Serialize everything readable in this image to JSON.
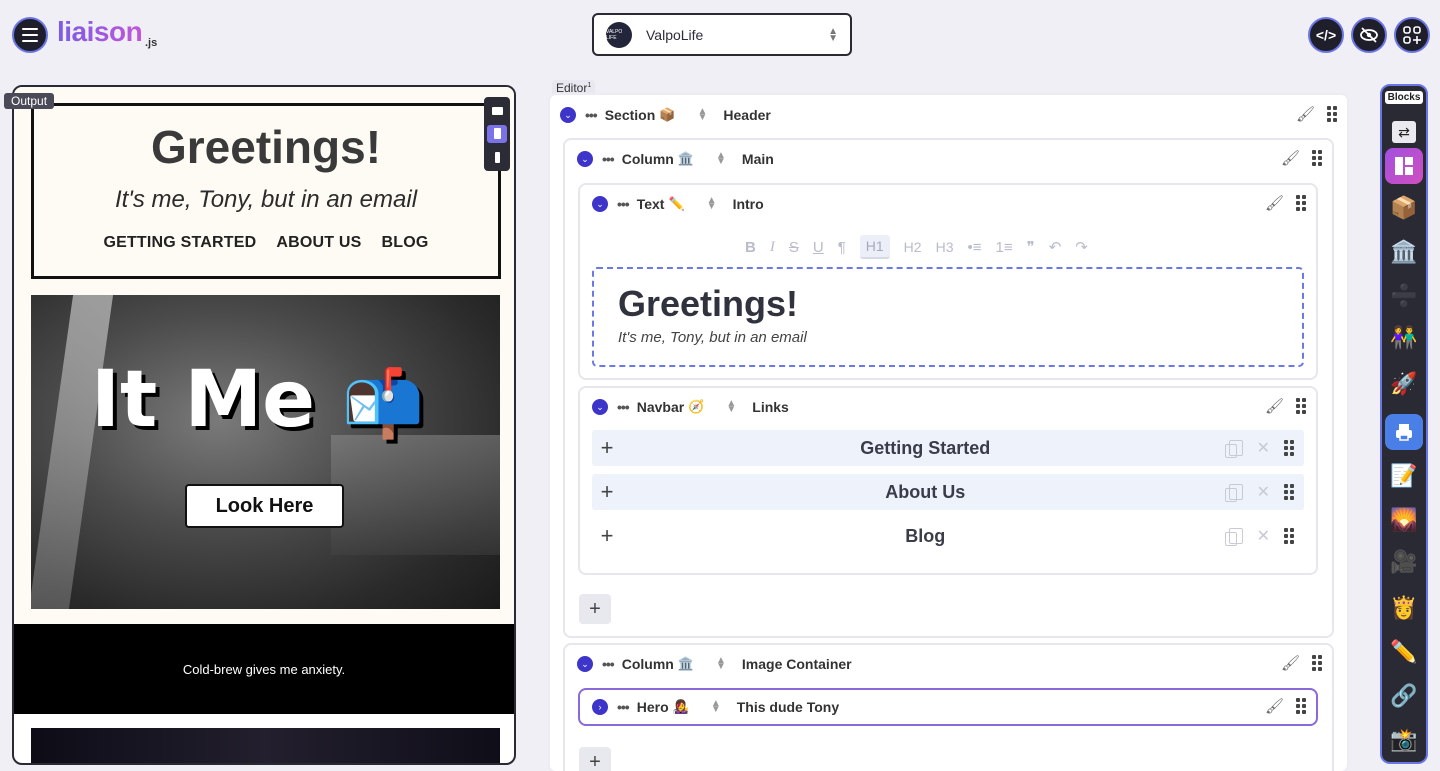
{
  "app": {
    "logo_text": "liaison",
    "logo_suffix": ".js",
    "site_name": "ValpoLife",
    "site_avatar_text": "VALPO LIFE",
    "code_icon": "code-icon",
    "hide_icon": "eye-slash-icon",
    "apps_icon": "apps-add-icon"
  },
  "output": {
    "tag": "Output",
    "email_title": "Greetings!",
    "email_subtitle": "It's me, Tony, but in an email",
    "nav": [
      "GETTING STARTED",
      "ABOUT US",
      "BLOG"
    ],
    "hero_title": "It Me",
    "hero_emoji": "📬",
    "hero_button": "Look Here",
    "band_text": "Cold-brew gives me anxiety."
  },
  "editor": {
    "tag": "Editor",
    "tag_sup": "1",
    "section": {
      "kind": "Section",
      "emoji": "📦",
      "name": "Header"
    },
    "column_main": {
      "kind": "Column",
      "emoji": "🏛️",
      "name": "Main"
    },
    "text_block": {
      "kind": "Text",
      "emoji": "✏️",
      "name": "Intro"
    },
    "toolbar": [
      "B",
      "I",
      "S",
      "U",
      "¶",
      "H1",
      "H2",
      "H3",
      "•≡",
      "1≡",
      "❞",
      "↶",
      "↷"
    ],
    "text_title": "Greetings!",
    "text_sub": "It's me, Tony, but in an email",
    "navbar": {
      "kind": "Navbar",
      "emoji": "🧭",
      "name": "Links"
    },
    "links": [
      "Getting Started",
      "About Us",
      "Blog"
    ],
    "add_label": "+",
    "column_image": {
      "kind": "Column",
      "emoji": "🏛️",
      "name": "Image Container"
    },
    "hero_block": {
      "kind": "Hero",
      "emoji": "👩‍🎤",
      "name": "This dude Tony"
    }
  },
  "blocks": {
    "label": "Blocks",
    "swap": "⇄",
    "items": [
      "📦",
      "🏛️",
      "➗",
      "👫",
      "🚀",
      "🖨️",
      "📝",
      "🌄",
      "🎥",
      "👸",
      "✏️",
      "🔗",
      "📸"
    ]
  }
}
